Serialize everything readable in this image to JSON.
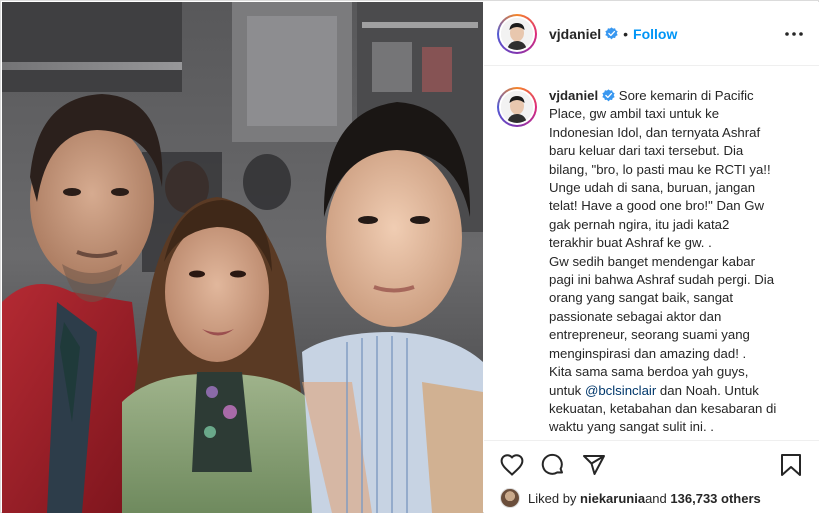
{
  "post": {
    "username": "vjdaniel",
    "separator": "•",
    "follow_label": "Follow",
    "more_label": "•••",
    "caption": {
      "username": "vjdaniel",
      "lines": [
        "Sore kemarin di Pacific",
        "Place, gw ambil taxi untuk ke",
        "Indonesian Idol, dan ternyata Ashraf",
        "baru keluar dari taxi tersebut. Dia",
        "bilang, \"bro, lo pasti mau ke RCTI ya!!",
        "Unge udah di sana, buruan, jangan",
        "telat! Have a good one bro!\" Dan Gw",
        "gak pernah ngira, itu jadi kata2",
        "terakhir buat Ashraf ke gw. .",
        "Gw sedih banget mendengar kabar",
        "pagi ini bahwa Ashraf sudah pergi. Dia",
        "orang yang sangat baik, sangat",
        "passionate sebagai aktor dan",
        "entrepreneur, seorang suami yang",
        "menginspirasi dan amazing dad! .",
        "Kita sama sama berdoa yah guys,"
      ],
      "line17_prefix": "untuk ",
      "mention": "@bclsinclair",
      "line17_suffix": " dan Noah. Untuk",
      "lines_after": [
        "kekuatan, ketabahan dan kesabaran di",
        "waktu yang sangat sulit ini. ."
      ]
    },
    "likes": {
      "prefix": "Liked by ",
      "liker": "niekarunia",
      "middle": " and ",
      "count": "136,733 others"
    },
    "icons": {
      "verified": "verified-badge-icon",
      "like": "heart-icon",
      "comment": "comment-icon",
      "share": "share-icon",
      "save": "bookmark-icon",
      "more": "more-options-icon"
    },
    "colors": {
      "link": "#0095f6",
      "mention": "#00376b",
      "text": "#262626",
      "border": "#dbdbdb"
    }
  }
}
